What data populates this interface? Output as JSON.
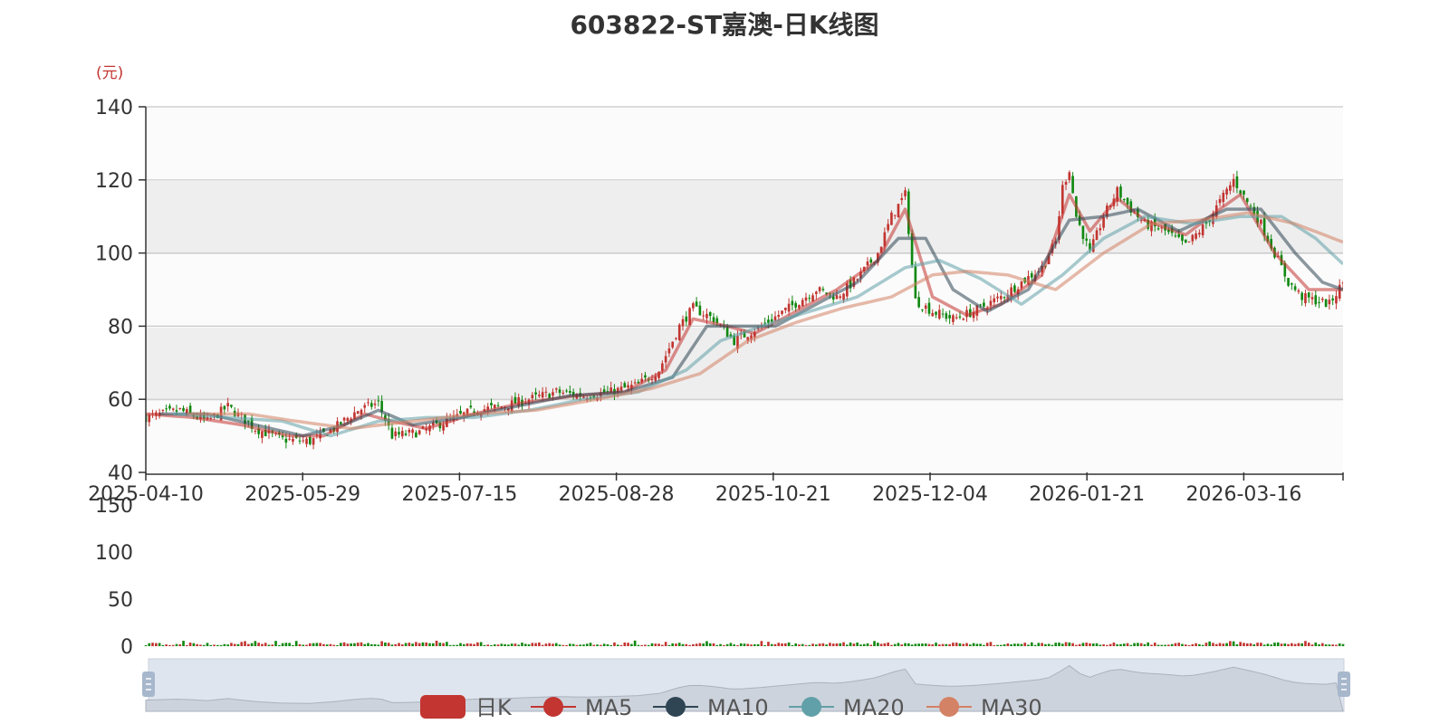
{
  "title": "603822-ST嘉澳-日K线图",
  "chart_data": {
    "type": "candlestick",
    "title": "603822-ST嘉澳-日K线图",
    "y_unit": "(元)",
    "ylim": [
      40,
      140
    ],
    "y_ticks": [
      40,
      60,
      80,
      100,
      120,
      140
    ],
    "x_tick_labels": [
      "2025-04-10",
      "2025-05-29",
      "2025-07-15",
      "2025-08-28",
      "2025-10-21",
      "2025-12-04",
      "2026-01-21",
      "2026-03-16"
    ],
    "volume_ylim": [
      0,
      150
    ],
    "volume_ticks": [
      0,
      50,
      100,
      150
    ],
    "legend": [
      "日K",
      "MA5",
      "MA10",
      "MA20",
      "MA30"
    ],
    "colors": {
      "up": "#c23531",
      "down": "#118811",
      "ma5": "#c23531",
      "ma10": "#2f4554",
      "ma20": "#61a0a8",
      "ma30": "#d48265",
      "grid_band": "#eeeeee",
      "slider_fill": "#dfe5ee"
    },
    "close_path": [
      [
        0,
        55
      ],
      [
        10,
        57
      ],
      [
        18,
        54
      ],
      [
        24,
        58
      ],
      [
        32,
        52
      ],
      [
        40,
        49
      ],
      [
        48,
        48.5
      ],
      [
        55,
        52
      ],
      [
        62,
        57
      ],
      [
        68,
        59
      ],
      [
        72,
        50
      ],
      [
        80,
        51
      ],
      [
        88,
        54
      ],
      [
        96,
        57
      ],
      [
        104,
        58
      ],
      [
        112,
        60
      ],
      [
        120,
        62
      ],
      [
        128,
        61
      ],
      [
        136,
        62
      ],
      [
        144,
        64
      ],
      [
        150,
        68
      ],
      [
        156,
        80
      ],
      [
        160,
        85
      ],
      [
        166,
        82
      ],
      [
        172,
        76
      ],
      [
        180,
        80
      ],
      [
        188,
        85
      ],
      [
        196,
        90
      ],
      [
        202,
        88
      ],
      [
        208,
        93
      ],
      [
        214,
        100
      ],
      [
        218,
        110
      ],
      [
        222,
        116
      ],
      [
        225,
        87
      ],
      [
        230,
        84
      ],
      [
        236,
        82
      ],
      [
        242,
        84
      ],
      [
        246,
        86
      ],
      [
        250,
        88
      ],
      [
        256,
        92
      ],
      [
        262,
        96
      ],
      [
        266,
        103
      ],
      [
        268,
        118
      ],
      [
        270,
        123
      ],
      [
        272,
        110
      ],
      [
        276,
        100
      ],
      [
        280,
        110
      ],
      [
        284,
        117
      ],
      [
        288,
        112
      ],
      [
        292,
        108
      ],
      [
        298,
        106
      ],
      [
        304,
        102
      ],
      [
        310,
        108
      ],
      [
        314,
        114
      ],
      [
        318,
        120
      ],
      [
        322,
        114
      ],
      [
        326,
        108
      ],
      [
        330,
        100
      ],
      [
        334,
        92
      ],
      [
        338,
        88
      ],
      [
        342,
        87
      ],
      [
        346,
        86
      ],
      [
        350,
        92
      ]
    ],
    "ma_paths": {
      "MA5": [
        [
          0,
          56
        ],
        [
          14,
          55
        ],
        [
          28,
          53
        ],
        [
          42,
          50
        ],
        [
          52,
          50
        ],
        [
          64,
          56
        ],
        [
          72,
          54
        ],
        [
          82,
          52
        ],
        [
          96,
          56
        ],
        [
          110,
          59
        ],
        [
          126,
          61
        ],
        [
          140,
          62
        ],
        [
          152,
          68
        ],
        [
          160,
          82
        ],
        [
          170,
          80
        ],
        [
          178,
          78
        ],
        [
          190,
          84
        ],
        [
          202,
          90
        ],
        [
          214,
          98
        ],
        [
          222,
          112
        ],
        [
          230,
          88
        ],
        [
          240,
          83
        ],
        [
          250,
          86
        ],
        [
          262,
          94
        ],
        [
          270,
          116
        ],
        [
          276,
          106
        ],
        [
          284,
          115
        ],
        [
          292,
          109
        ],
        [
          304,
          105
        ],
        [
          314,
          112
        ],
        [
          320,
          116
        ],
        [
          330,
          100
        ],
        [
          340,
          90
        ],
        [
          350,
          90
        ]
      ],
      "MA10": [
        [
          4,
          56
        ],
        [
          18,
          56
        ],
        [
          32,
          53
        ],
        [
          46,
          50
        ],
        [
          58,
          53
        ],
        [
          68,
          57
        ],
        [
          78,
          53
        ],
        [
          92,
          55
        ],
        [
          108,
          58
        ],
        [
          124,
          61
        ],
        [
          140,
          62
        ],
        [
          154,
          66
        ],
        [
          164,
          80
        ],
        [
          174,
          80
        ],
        [
          184,
          80
        ],
        [
          196,
          86
        ],
        [
          208,
          92
        ],
        [
          220,
          104
        ],
        [
          228,
          104
        ],
        [
          236,
          90
        ],
        [
          246,
          84
        ],
        [
          258,
          90
        ],
        [
          270,
          109
        ],
        [
          280,
          110
        ],
        [
          290,
          112
        ],
        [
          302,
          106
        ],
        [
          316,
          112
        ],
        [
          326,
          112
        ],
        [
          336,
          100
        ],
        [
          344,
          92
        ],
        [
          350,
          90
        ]
      ],
      "MA20": [
        [
          8,
          56
        ],
        [
          24,
          55
        ],
        [
          40,
          54
        ],
        [
          54,
          50
        ],
        [
          68,
          54
        ],
        [
          82,
          55
        ],
        [
          96,
          55
        ],
        [
          112,
          57
        ],
        [
          128,
          60
        ],
        [
          144,
          62
        ],
        [
          158,
          68
        ],
        [
          168,
          76
        ],
        [
          180,
          80
        ],
        [
          194,
          84
        ],
        [
          208,
          88
        ],
        [
          222,
          96
        ],
        [
          232,
          98
        ],
        [
          244,
          93
        ],
        [
          256,
          86
        ],
        [
          268,
          94
        ],
        [
          280,
          104
        ],
        [
          292,
          110
        ],
        [
          306,
          108
        ],
        [
          320,
          110
        ],
        [
          332,
          110
        ],
        [
          342,
          104
        ],
        [
          350,
          97
        ]
      ],
      "MA30": [
        [
          12,
          56
        ],
        [
          30,
          56
        ],
        [
          44,
          54
        ],
        [
          60,
          52
        ],
        [
          78,
          54
        ],
        [
          96,
          56
        ],
        [
          114,
          57
        ],
        [
          132,
          60
        ],
        [
          148,
          63
        ],
        [
          162,
          67
        ],
        [
          176,
          76
        ],
        [
          190,
          81
        ],
        [
          204,
          85
        ],
        [
          218,
          88
        ],
        [
          230,
          94
        ],
        [
          240,
          95
        ],
        [
          252,
          94
        ],
        [
          266,
          90
        ],
        [
          280,
          100
        ],
        [
          294,
          108
        ],
        [
          308,
          109
        ],
        [
          322,
          111
        ],
        [
          336,
          108
        ],
        [
          350,
          103
        ]
      ]
    }
  },
  "legend_items": [
    "日K",
    "MA5",
    "MA10",
    "MA20",
    "MA30"
  ]
}
